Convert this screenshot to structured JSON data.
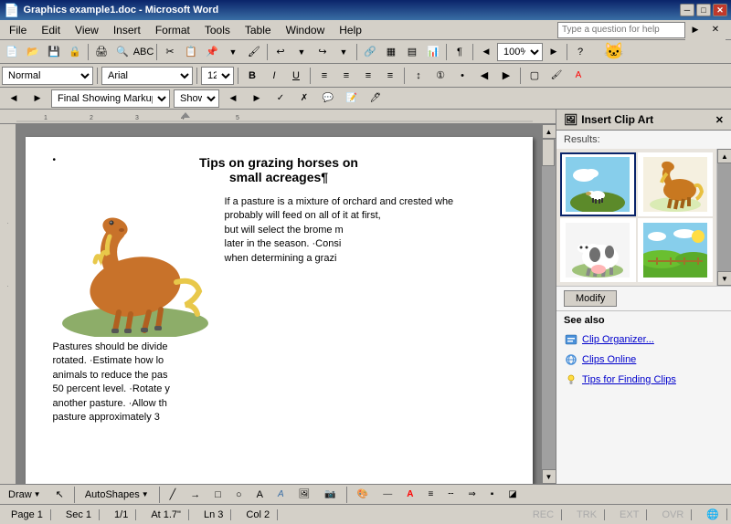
{
  "titlebar": {
    "title": "Graphics example1.doc - Microsoft Word",
    "minimize": "─",
    "maximize": "□",
    "close": "✕"
  },
  "menu": {
    "items": [
      "File",
      "Edit",
      "View",
      "Insert",
      "Format",
      "Tools",
      "Table",
      "Window",
      "Help"
    ]
  },
  "toolbar1": {
    "zoom": "100%",
    "help_placeholder": "Type a question for help"
  },
  "toolbar2": {
    "style": "Normal",
    "font": "Arial",
    "size": "12"
  },
  "tracking": {
    "mode": "Final Showing Markup",
    "show": "Show"
  },
  "document": {
    "title": "Tips on grazing horses on\nsmall acreages¶",
    "para1": "If a pasture is a mixture of orchard and crested wheatgrass, horses probably will feed on all of it at first, but will select the brome and orchardgrass later in the season. Consider this when determining a grazing...",
    "para2": "Pastures should be divided and rotated. Estimate how long it takes animals to reduce the pasture to a 50 percent level. Rotate your horses to another pasture. Allow the original pasture approximately 3..."
  },
  "clip_art_panel": {
    "title": "Insert Clip Art",
    "results_label": "Results:",
    "modify_btn": "Modify",
    "see_also_label": "See also",
    "see_also_items": [
      {
        "label": "Clip Organizer...",
        "icon": "organizer"
      },
      {
        "label": "Clips Online",
        "icon": "online"
      },
      {
        "label": "Tips for Finding Clips",
        "icon": "tips"
      }
    ]
  },
  "statusbar": {
    "page": "Page 1",
    "sec": "Sec 1",
    "position": "1/1",
    "at": "At 1.7\"",
    "ln": "Ln 3",
    "col": "Col 2",
    "rec": "REC",
    "trk": "TRK",
    "ext": "EXT",
    "ovr": "OVR"
  },
  "draw_toolbar": {
    "draw_label": "Draw",
    "autoshapes": "AutoShapes"
  }
}
